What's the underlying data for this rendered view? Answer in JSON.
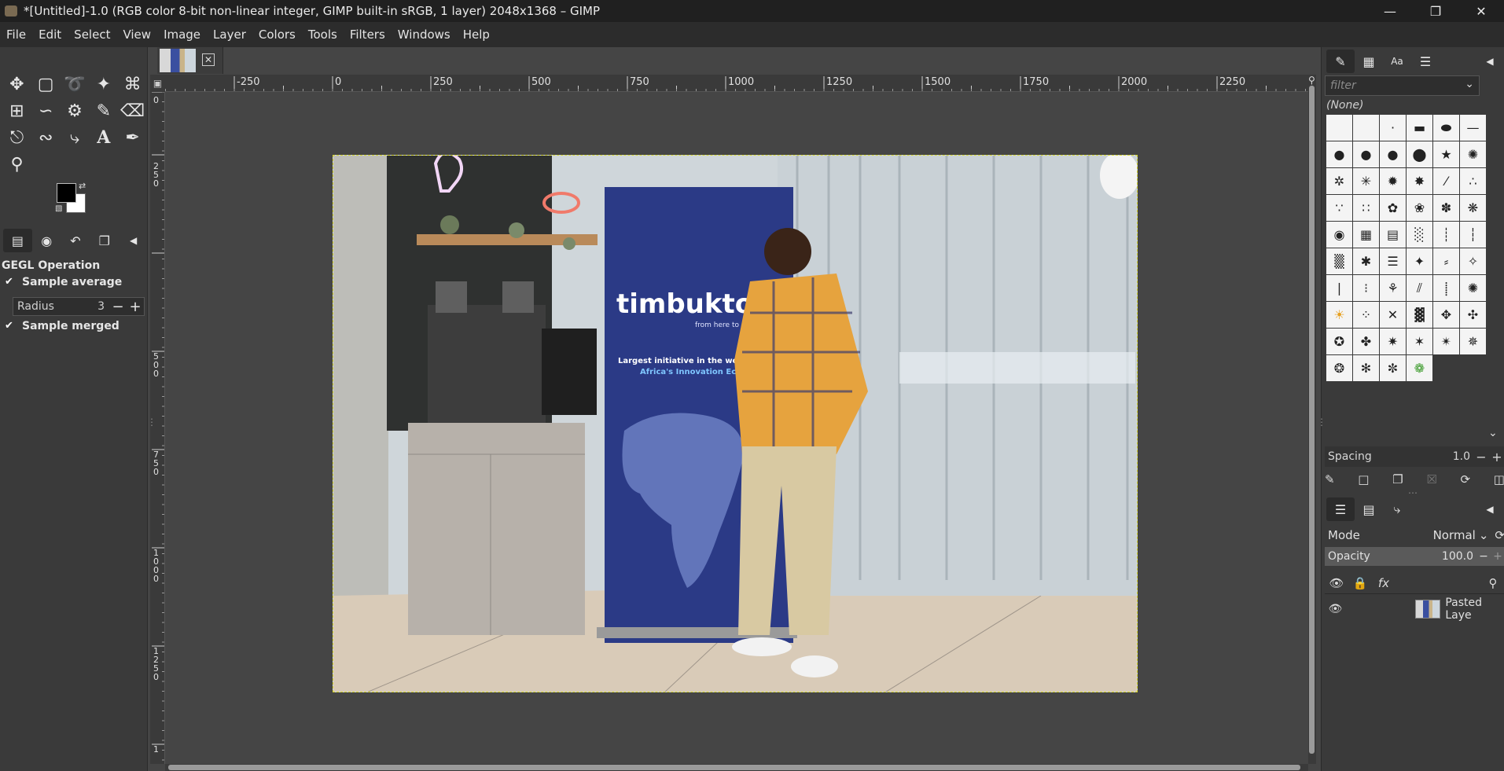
{
  "window": {
    "title": "*[Untitled]-1.0 (RGB color 8-bit non-linear integer, GIMP built-in sRGB, 1 layer) 2048x1368 – GIMP"
  },
  "menu": [
    "File",
    "Edit",
    "Select",
    "View",
    "Image",
    "Layer",
    "Colors",
    "Tools",
    "Filters",
    "Windows",
    "Help"
  ],
  "tool_options": {
    "title": "GEGL Operation",
    "sample_average": "Sample average",
    "radius_label": "Radius",
    "radius_value": "3",
    "sample_merged": "Sample merged"
  },
  "ruler": {
    "h_ticks": [
      "-250",
      "0",
      "250",
      "500",
      "750",
      "1000",
      "1250",
      "1500",
      "1750",
      "2000",
      "2250"
    ],
    "v_ticks": [
      "0",
      "2\n5\n0",
      "5\n0\n0",
      "7\n5\n0",
      "1\n0\n0\n0",
      "1\n2\n5\n0",
      "1"
    ]
  },
  "image": {
    "banner_brand": "timbuktoo",
    "banner_tagline": "from here to Africa",
    "banner_line1": "Largest initiative in the world sup...",
    "banner_line2": "Africa's Innovation Ecosyst..."
  },
  "brushes": {
    "filter_placeholder": "filter",
    "selected": "(None)",
    "spacing_label": "Spacing",
    "spacing_value": "1.0"
  },
  "layers": {
    "mode_label": "Mode",
    "mode_value": "Normal",
    "opacity_label": "Opacity",
    "opacity_value": "100.0",
    "layer_name": "Pasted Laye"
  }
}
